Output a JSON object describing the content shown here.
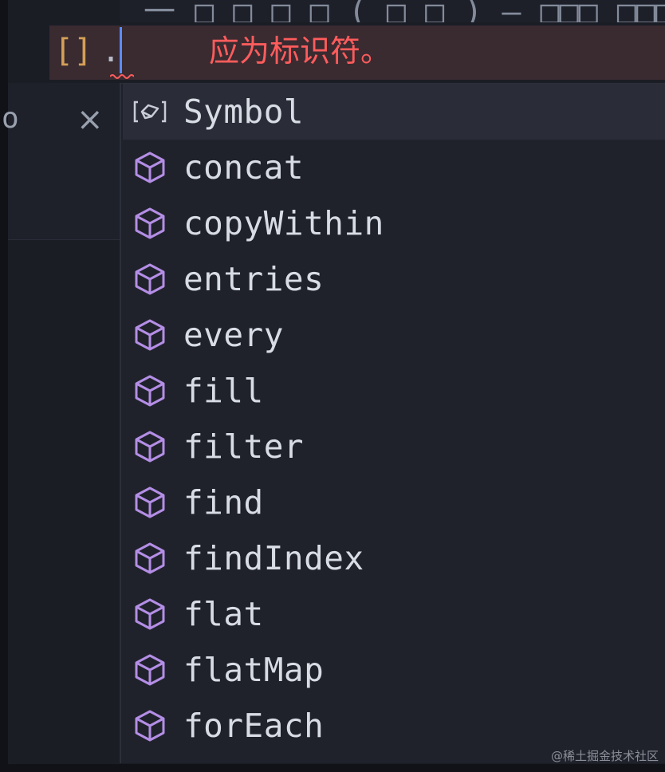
{
  "editor": {
    "top_fragment": "一 □ □ □ □ ( □ □ ) — □□□ □□□□□□",
    "code_bracket": "[]",
    "code_dot": ".",
    "error_message": "应为标识符。"
  },
  "side_tab": {
    "label_fragment": "o",
    "close_glyph": "×"
  },
  "suggestions": [
    {
      "label": "Symbol",
      "kind": "variable"
    },
    {
      "label": "concat",
      "kind": "method"
    },
    {
      "label": "copyWithin",
      "kind": "method"
    },
    {
      "label": "entries",
      "kind": "method"
    },
    {
      "label": "every",
      "kind": "method"
    },
    {
      "label": "fill",
      "kind": "method"
    },
    {
      "label": "filter",
      "kind": "method"
    },
    {
      "label": "find",
      "kind": "method"
    },
    {
      "label": "findIndex",
      "kind": "method"
    },
    {
      "label": "flat",
      "kind": "method"
    },
    {
      "label": "flatMap",
      "kind": "method"
    },
    {
      "label": "forEach",
      "kind": "method"
    }
  ],
  "selected_index": 0,
  "colors": {
    "method_icon": "#b48ee6",
    "variable_icon": "#c8ccd6",
    "error": "#ff5c5c",
    "cursor": "#5b8cff"
  },
  "watermark": "@稀土掘金技术社区"
}
